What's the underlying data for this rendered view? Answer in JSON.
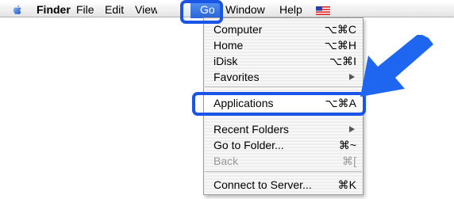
{
  "menubar": {
    "finder": "Finder",
    "file": "File",
    "edit": "Edit",
    "view": "View",
    "go": "Go",
    "window": "Window",
    "help": "Help"
  },
  "go_menu": {
    "items": [
      {
        "label": "Computer",
        "shortcut": "⌥⌘C"
      },
      {
        "label": "Home",
        "shortcut": "⌥⌘H"
      },
      {
        "label": "iDisk",
        "shortcut": "⌥⌘I"
      },
      {
        "label": "Favorites",
        "submenu": true
      },
      {
        "label": "Applications",
        "shortcut": "⌥⌘A",
        "highlighted": true
      },
      {
        "label": "Recent Folders",
        "submenu": true
      },
      {
        "label": "Go to Folder...",
        "shortcut": "⌘~"
      },
      {
        "label": "Back",
        "shortcut": "⌘[",
        "disabled": true
      },
      {
        "label": "Connect to Server...",
        "shortcut": "⌘K"
      }
    ]
  },
  "colors": {
    "callout_blue": "#1a55e8",
    "arrow_blue": "#1e66f0",
    "menu_highlight": "#3a75e0"
  },
  "icons": {
    "apple": "apple-icon",
    "flag": "us-flag-icon",
    "arrow": "pointer-arrow"
  }
}
